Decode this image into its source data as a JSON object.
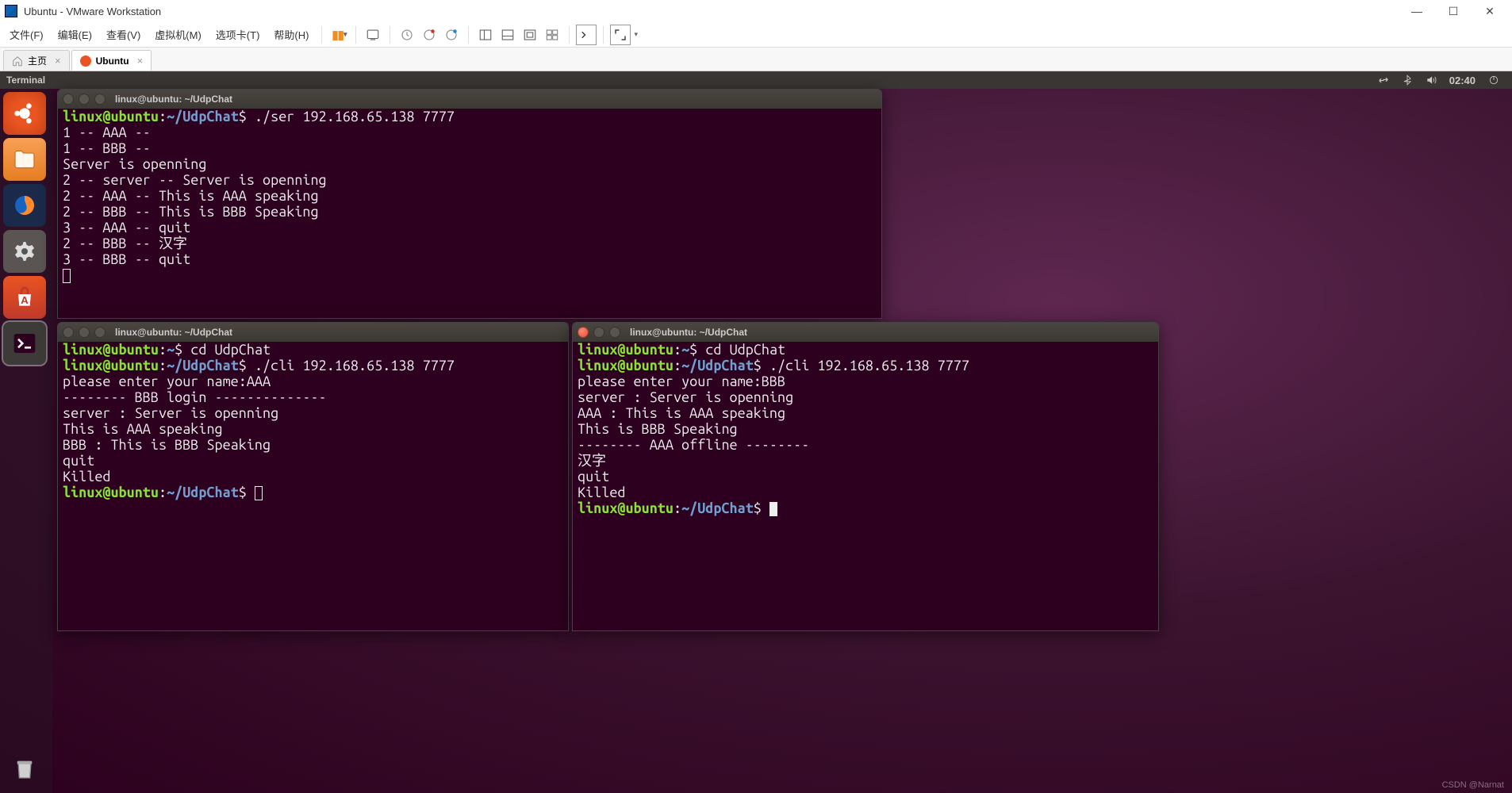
{
  "window": {
    "title": "Ubuntu - VMware Workstation"
  },
  "menu": {
    "items": [
      "文件(F)",
      "编辑(E)",
      "查看(V)",
      "虚拟机(M)",
      "选项卡(T)",
      "帮助(H)"
    ]
  },
  "tabs": {
    "home": "主页",
    "vm": "Ubuntu"
  },
  "ubuntu_top": {
    "app": "Terminal",
    "time": "02:40"
  },
  "terminals": {
    "t1": {
      "title": "linux@ubuntu: ~/UdpChat",
      "prompt_user": "linux@ubuntu",
      "prompt_path": "~/UdpChat",
      "cmd": "./ser 192.168.65.138 7777",
      "lines": [
        "1 -- AAA --",
        "1 -- BBB --",
        "Server is openning",
        "2 -- server -- Server is openning",
        "2 -- AAA -- This is AAA speaking",
        "2 -- BBB -- This is BBB Speaking",
        "3 -- AAA -- quit",
        "2 -- BBB -- 汉字",
        "3 -- BBB -- quit"
      ]
    },
    "t2": {
      "title": "linux@ubuntu: ~/UdpChat",
      "prompt_user": "linux@ubuntu",
      "home_path": "~",
      "path": "~/UdpChat",
      "cmd1": "cd UdpChat",
      "cmd2": "./cli 192.168.65.138 7777",
      "lines": [
        "please enter your name:AAA",
        "-------- BBB login --------------",
        "server : Server is openning",
        "This is AAA speaking",
        "BBB : This is BBB Speaking",
        "quit",
        "Killed"
      ]
    },
    "t3": {
      "title": "linux@ubuntu: ~/UdpChat",
      "prompt_user": "linux@ubuntu",
      "home_path": "~",
      "path": "~/UdpChat",
      "cmd1": "cd UdpChat",
      "cmd2": "./cli 192.168.65.138 7777",
      "lines": [
        "please enter your name:BBB",
        "server : Server is openning",
        "AAA : This is AAA speaking",
        "This is BBB Speaking",
        "-------- AAA offline --------",
        "汉字",
        "quit",
        "Killed"
      ]
    }
  },
  "watermark": "CSDN @Narnat"
}
